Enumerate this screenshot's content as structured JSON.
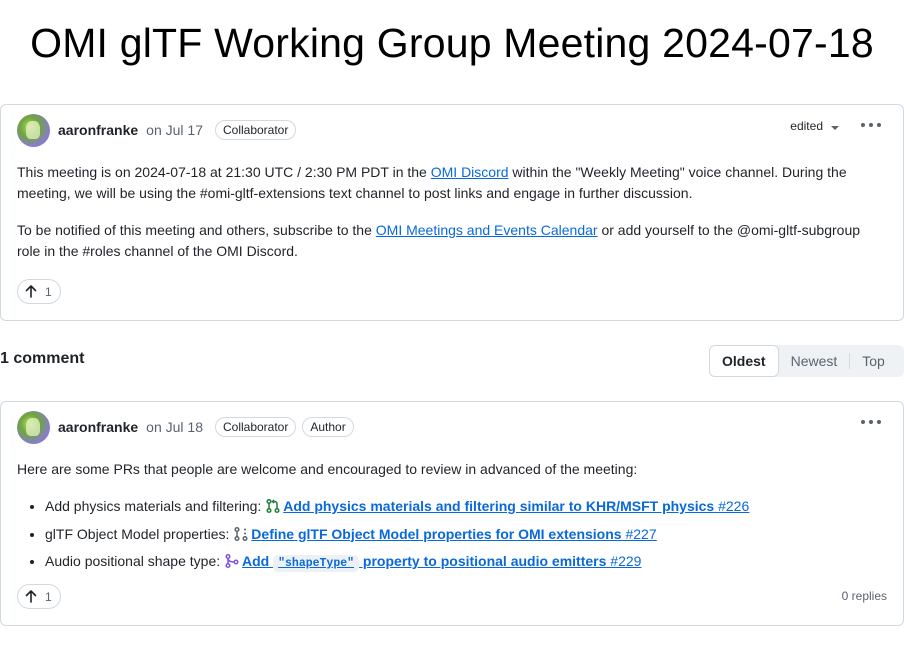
{
  "page": {
    "title": "OMI glTF Working Group Meeting 2024-07-18"
  },
  "post": {
    "author": "aaronfranke",
    "date": "on Jul 17",
    "badge": "Collaborator",
    "edited_label": "edited",
    "para1": {
      "before": "This meeting is on 2024-07-18 at 21:30 UTC / 2:30 PM PDT in the ",
      "link": "OMI Discord",
      "after": " within the \"Weekly Meeting\" voice channel. During the meeting, we will be using the #omi-gltf-extensions text channel to post links and engage in further discussion."
    },
    "para2": {
      "before": "To be notified of this meeting and others, subscribe to the ",
      "link": "OMI Meetings and Events Calendar",
      "after": " or add yourself to the @omi-gltf-subgroup role in the #roles channel of the OMI Discord."
    },
    "reaction_count": "1"
  },
  "comments_header": {
    "count_label": "1 comment",
    "sort_options": [
      "Oldest",
      "Newest",
      "Top"
    ],
    "selected": "Oldest"
  },
  "comment": {
    "author": "aaronfranke",
    "date": "on Jul 18",
    "badges": [
      "Collaborator",
      "Author"
    ],
    "intro": "Here are some PRs that people are welcome and encouraged to review in advanced of the meeting:",
    "items": [
      {
        "label": "Add physics materials and filtering: ",
        "icon": "pull-request-open-icon",
        "title": "Add physics materials and filtering similar to KHR/MSFT physics",
        "number": "#226"
      },
      {
        "label": "glTF Object Model properties: ",
        "icon": "pull-request-draft-icon",
        "title": "Define glTF Object Model properties for OMI extensions",
        "number": "#227"
      },
      {
        "label": "Audio positional shape type: ",
        "icon": "pull-request-merged-icon",
        "title_before": "Add ",
        "title_code": "\"shapeType\"",
        "title_after": " property to positional audio emitters",
        "number": "#229"
      }
    ],
    "reaction_count": "1",
    "replies": "0 replies"
  },
  "colors": {
    "link": "#0969da",
    "open": "#1a7f37",
    "merged": "#8250df",
    "draft": "#59636e"
  }
}
